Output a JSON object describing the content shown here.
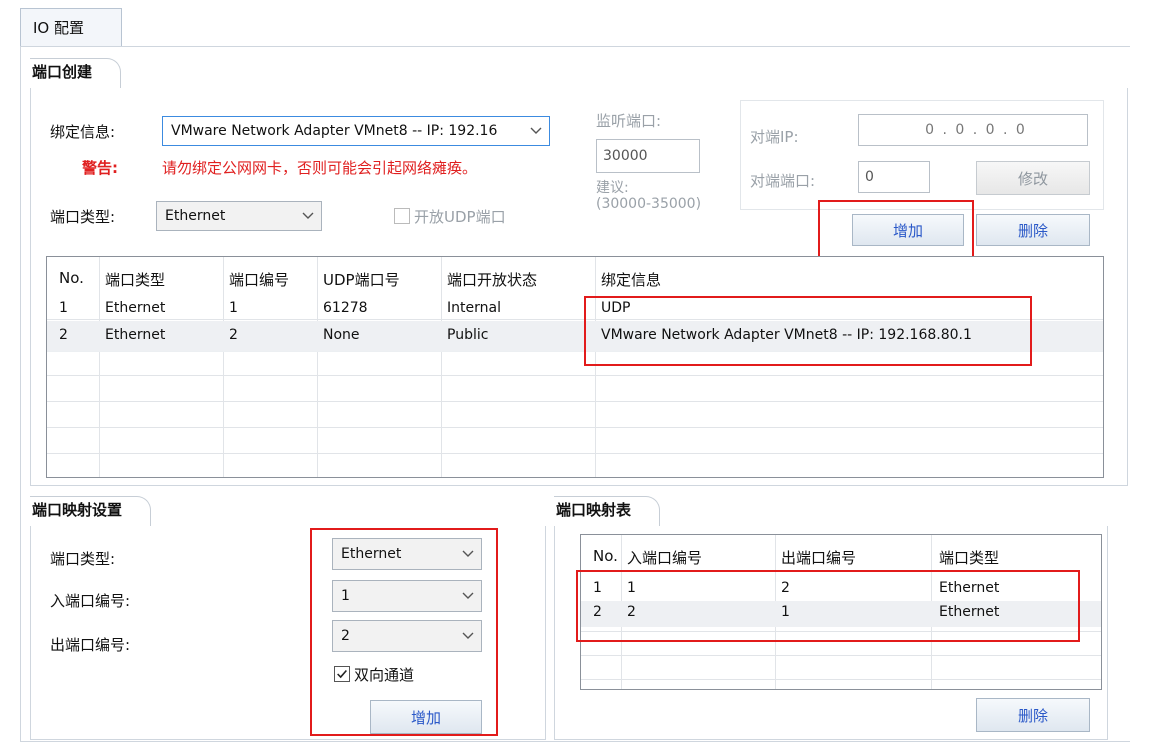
{
  "tab": {
    "label": "IO 配置"
  },
  "port_create": {
    "title": "端口创建",
    "bind_label": "绑定信息:",
    "bind_value": "VMware Network Adapter VMnet8 -- IP: 192.16",
    "warning_label": "警告:",
    "warning_text": "请勿绑定公网网卡，否则可能会引起网络瘫痪。",
    "port_type_label": "端口类型:",
    "port_type_value": "Ethernet",
    "udp_checkbox_label": "开放UDP端口",
    "listen_label": "监听端口:",
    "listen_value": "30000",
    "suggest_label": "建议:",
    "suggest_range": "(30000-35000)",
    "peer_ip_label": "对端IP:",
    "peer_ip_value": "0 . 0 . 0 . 0",
    "peer_port_label": "对端端口:",
    "peer_port_value": "0",
    "modify_button": "修改",
    "add_button": "增加",
    "delete_button": "删除"
  },
  "port_table": {
    "columns": [
      "No.",
      "端口类型",
      "端口编号",
      "UDP端口号",
      "端口开放状态",
      "绑定信息"
    ],
    "rows": [
      [
        "1",
        "Ethernet",
        "1",
        "61278",
        "Internal",
        "UDP"
      ],
      [
        "2",
        "Ethernet",
        "2",
        "None",
        "Public",
        "VMware Network Adapter VMnet8 -- IP: 192.168.80.1"
      ]
    ]
  },
  "mapping_settings": {
    "title": "端口映射设置",
    "port_type_label": "端口类型:",
    "in_port_label": "入端口编号:",
    "out_port_label": "出端口编号:",
    "port_type_value": "Ethernet",
    "in_port_value": "1",
    "out_port_value": "2",
    "bidirectional_label": "双向通道",
    "bidirectional_checked": true,
    "add_button": "增加"
  },
  "mapping_table": {
    "title": "端口映射表",
    "columns": [
      "No.",
      "入端口编号",
      "出端口编号",
      "端口类型"
    ],
    "rows": [
      [
        "1",
        "1",
        "2",
        "Ethernet"
      ],
      [
        "2",
        "2",
        "1",
        "Ethernet"
      ]
    ],
    "delete_button": "删除"
  },
  "colors": {
    "warning": "#e02020",
    "highlight_box": "#e21b1b",
    "button_text": "#2a58c8",
    "focus_border": "#3c8be0"
  }
}
